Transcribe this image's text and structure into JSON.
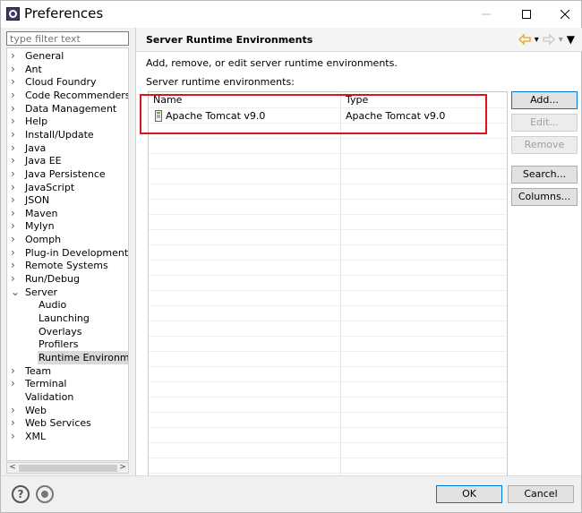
{
  "window": {
    "title": "Preferences"
  },
  "sidebar": {
    "filter_placeholder": "type filter text",
    "items": [
      {
        "label": "General",
        "expandable": true
      },
      {
        "label": "Ant",
        "expandable": true
      },
      {
        "label": "Cloud Foundry",
        "expandable": true
      },
      {
        "label": "Code Recommenders",
        "expandable": true
      },
      {
        "label": "Data Management",
        "expandable": true
      },
      {
        "label": "Help",
        "expandable": true
      },
      {
        "label": "Install/Update",
        "expandable": true
      },
      {
        "label": "Java",
        "expandable": true
      },
      {
        "label": "Java EE",
        "expandable": true
      },
      {
        "label": "Java Persistence",
        "expandable": true
      },
      {
        "label": "JavaScript",
        "expandable": true
      },
      {
        "label": "JSON",
        "expandable": true
      },
      {
        "label": "Maven",
        "expandable": true
      },
      {
        "label": "Mylyn",
        "expandable": true
      },
      {
        "label": "Oomph",
        "expandable": true
      },
      {
        "label": "Plug-in Development",
        "expandable": true
      },
      {
        "label": "Remote Systems",
        "expandable": true
      },
      {
        "label": "Run/Debug",
        "expandable": true
      },
      {
        "label": "Server",
        "expandable": true,
        "expanded": true
      },
      {
        "label": "Audio",
        "child": true
      },
      {
        "label": "Launching",
        "child": true
      },
      {
        "label": "Overlays",
        "child": true
      },
      {
        "label": "Profilers",
        "child": true
      },
      {
        "label": "Runtime Environments",
        "child": true,
        "selected": true
      },
      {
        "label": "Team",
        "expandable": true
      },
      {
        "label": "Terminal",
        "expandable": true
      },
      {
        "label": "Validation",
        "expandable": false
      },
      {
        "label": "Web",
        "expandable": true
      },
      {
        "label": "Web Services",
        "expandable": true
      },
      {
        "label": "XML",
        "expandable": true
      }
    ]
  },
  "page": {
    "title": "Server Runtime Environments",
    "description": "Add, remove, or edit server runtime environments.",
    "list_label": "Server runtime environments:",
    "table": {
      "columns": [
        "Name",
        "Type"
      ],
      "rows": [
        {
          "name": "Apache Tomcat v9.0",
          "type": "Apache Tomcat v9.0"
        }
      ]
    },
    "buttons": {
      "add": "Add...",
      "edit": "Edit...",
      "remove": "Remove",
      "search": "Search...",
      "columns": "Columns..."
    }
  },
  "footer": {
    "ok": "OK",
    "cancel": "Cancel"
  },
  "colors": {
    "highlight": "#e0131c",
    "accent": "#0078d7",
    "nav_arrow": "#e8a317"
  }
}
